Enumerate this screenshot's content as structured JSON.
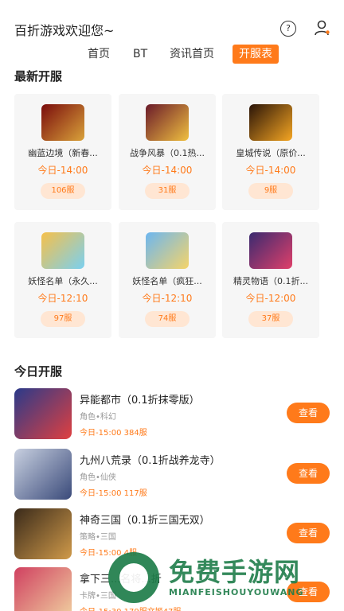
{
  "header": {
    "app_title": "百折游戏欢迎您~",
    "help_icon_glyph": "?",
    "tabs": [
      {
        "label": "首页"
      },
      {
        "label": "BT"
      },
      {
        "label": "资讯首页"
      },
      {
        "label": "开服表"
      }
    ],
    "active_tab": "开服表"
  },
  "latest_section": {
    "title": "最新开服",
    "cards": [
      {
        "name": "幽蓝边境（新春...",
        "time": "今日-14:00",
        "server": "106服",
        "thumb_colors": [
          "#7a0c0c",
          "#d9a23a"
        ]
      },
      {
        "name": "战争风暴（0.1热...",
        "time": "今日-14:00",
        "server": "31服",
        "thumb_colors": [
          "#6a1a2a",
          "#f0c040"
        ]
      },
      {
        "name": "皇城传说（原价...",
        "time": "今日-14:00",
        "server": "9服",
        "thumb_colors": [
          "#2a1408",
          "#f5a623"
        ]
      },
      {
        "name": "妖怪名单（永久...",
        "time": "今日-12:10",
        "server": "97服",
        "thumb_colors": [
          "#f6c04a",
          "#7ad0f0"
        ]
      },
      {
        "name": "妖怪名单（疯狂...",
        "time": "今日-12:10",
        "server": "74服",
        "thumb_colors": [
          "#6cb6f0",
          "#f5d46a"
        ]
      },
      {
        "name": "精灵物语（0.1折...",
        "time": "今日-12:00",
        "server": "37服",
        "thumb_colors": [
          "#3a2a70",
          "#e0406a"
        ]
      }
    ]
  },
  "today_section": {
    "title": "今日开服",
    "button_label": "查看",
    "games": [
      {
        "name": "异能都市（0.1折抹零版）",
        "tags": "角色•科幻",
        "meta": "今日-15:00 384服",
        "icon_colors": [
          "#2a3a8a",
          "#e04040"
        ]
      },
      {
        "name": "九州八荒录（0.1折战养龙寺）",
        "tags": "角色•仙侠",
        "meta": "今日-15:00 117服",
        "icon_colors": [
          "#c8d0e0",
          "#3a4a7a"
        ]
      },
      {
        "name": "神奇三国（0.1折三国无双）",
        "tags": "策略•三国",
        "meta": "今日-15:00 4服",
        "icon_colors": [
          "#3a2a1a",
          "#d09a4a"
        ]
      },
      {
        "name": "拿下三...名将...折",
        "tags": "卡牌•三国",
        "meta": "今日-15:30 179服文姬47服",
        "icon_colors": [
          "#d04060",
          "#f0d0a0"
        ]
      }
    ]
  },
  "watermark": {
    "text": "免费手游网",
    "sub": "MIANFEISHOUYOUWANG",
    "color": "#1f7d4a"
  },
  "accent_color": "#ff7a1a"
}
